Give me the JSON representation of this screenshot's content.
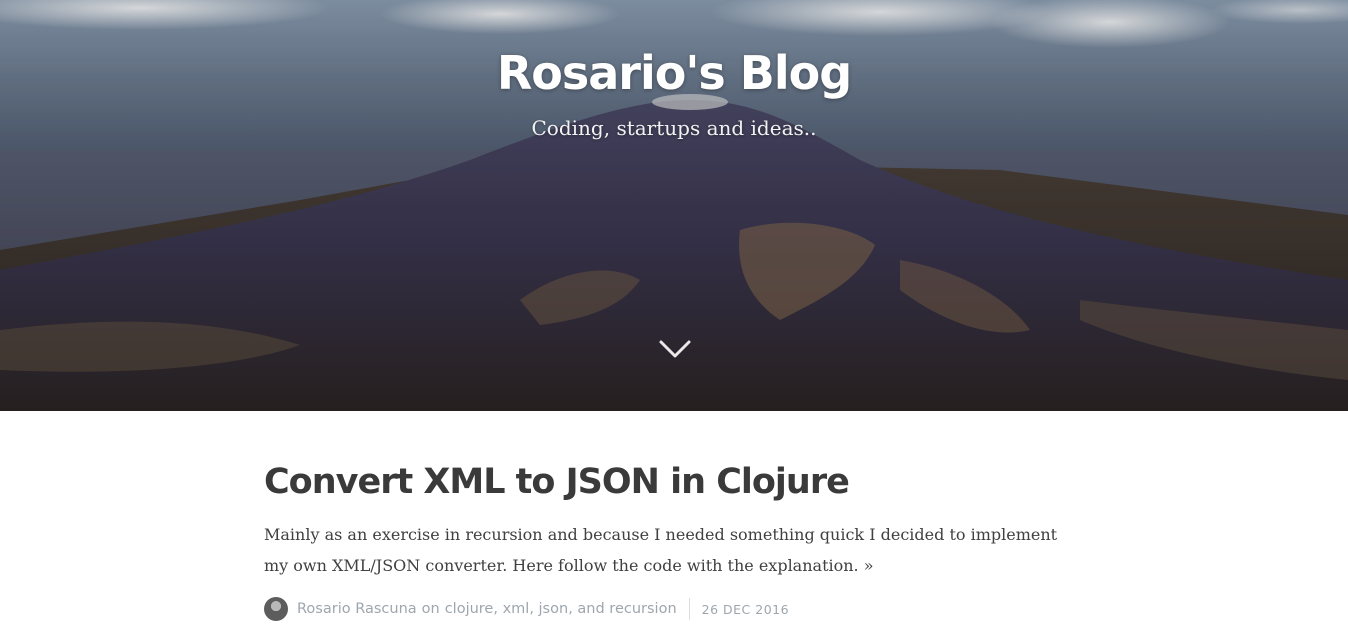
{
  "hero": {
    "title": "Rosario's Blog",
    "subtitle": "Coding, startups and ideas..",
    "scroll_icon": "chevron-down-icon"
  },
  "post": {
    "title": "Convert XML to JSON in Clojure",
    "excerpt": "Mainly as an exercise in recursion and because I needed something quick I decided to implement my own XML/JSON converter. Here follow the code with the explanation.",
    "read_more": "»",
    "author": "Rosario Rascuna",
    "on_word": "on",
    "tags": [
      "clojure",
      "xml",
      "json",
      "recursion"
    ],
    "tag_sep": ",",
    "tag_and": "and",
    "date": "26 DEC 2016"
  },
  "colors": {
    "title_text": "#3a3a3a",
    "body_text": "#404040",
    "meta_text": "#9ea6ad"
  }
}
